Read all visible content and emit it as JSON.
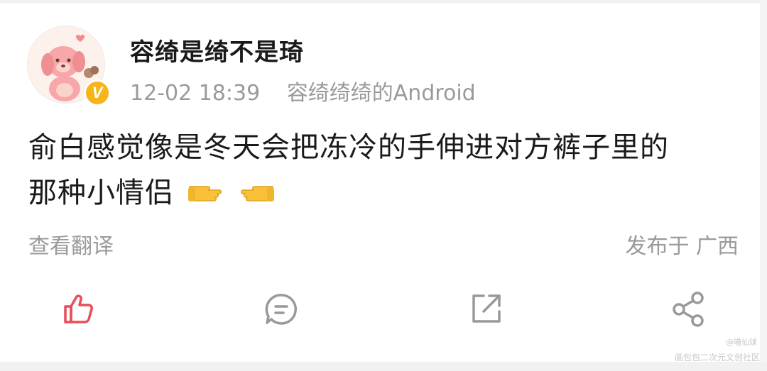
{
  "post": {
    "username": "容绮是绮不是琦",
    "timestamp": "12-02 18:39",
    "source": "容绮绮绮的Android",
    "verified_badge": "V",
    "content_line1": "俞白感觉像是冬天会把冻冷的手伸进对方裤子里的",
    "content_line2": "那种小情侣",
    "emojis": [
      "pointing-right-hand",
      "pointing-left-hand"
    ],
    "translate_label": "查看翻译",
    "location_label": "发布于 广西"
  },
  "actions": {
    "like_icon": "thumbs-up-icon",
    "comment_icon": "comment-icon",
    "repost_icon": "share-external-icon",
    "share_icon": "share-nodes-icon",
    "like_color": "#ea4d5a",
    "icon_color": "#999999"
  },
  "watermark": {
    "line1": "@喵仙球",
    "line2": "画包包二次元文创社区"
  },
  "colors": {
    "text_primary": "#1a1a1a",
    "text_secondary": "#9a9a9a",
    "badge_gold": "#f6b51b"
  }
}
